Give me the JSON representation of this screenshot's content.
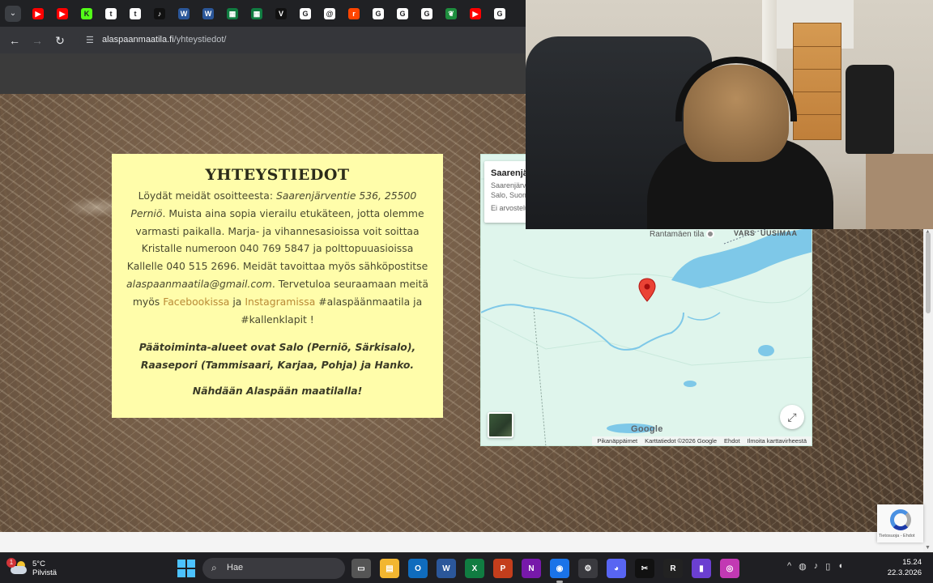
{
  "browser": {
    "tab_icons": [
      {
        "name": "youtube-icon",
        "color": "#ff0000",
        "glyph": "▶"
      },
      {
        "name": "youtube-icon",
        "color": "#ff0000",
        "glyph": "▶"
      },
      {
        "name": "kick-icon",
        "color": "#53fc18",
        "glyph": "K"
      },
      {
        "name": "tiktok-icon",
        "color": "#ffffff",
        "glyph": "t"
      },
      {
        "name": "tiktok-icon",
        "color": "#ffffff",
        "glyph": "t"
      },
      {
        "name": "tiktok-dark-icon",
        "color": "#111111",
        "glyph": "♪"
      },
      {
        "name": "word-icon",
        "color": "#2b579a",
        "glyph": "W"
      },
      {
        "name": "word-icon",
        "color": "#2b579a",
        "glyph": "W"
      },
      {
        "name": "sheets-icon",
        "color": "#107c41",
        "glyph": "▦"
      },
      {
        "name": "sheets-icon",
        "color": "#107c41",
        "glyph": "▦"
      },
      {
        "name": "vercel-icon",
        "color": "#111111",
        "glyph": "V"
      },
      {
        "name": "google-icon",
        "color": "#ffffff",
        "glyph": "G"
      },
      {
        "name": "threads-icon",
        "color": "#ffffff",
        "glyph": "@"
      },
      {
        "name": "reddit-icon",
        "color": "#ff4500",
        "glyph": "r"
      },
      {
        "name": "google-icon",
        "color": "#ffffff",
        "glyph": "G"
      },
      {
        "name": "google-icon",
        "color": "#ffffff",
        "glyph": "G"
      },
      {
        "name": "google-icon",
        "color": "#ffffff",
        "glyph": "G"
      },
      {
        "name": "leaf-icon",
        "color": "#1e8e3e",
        "glyph": "❦"
      },
      {
        "name": "youtube-icon",
        "color": "#ff0000",
        "glyph": "▶"
      },
      {
        "name": "google-icon",
        "color": "#ffffff",
        "glyph": "G"
      }
    ],
    "url_domain": "alaspaanmaatila.fi",
    "url_path": "/yhteystiedot/"
  },
  "contact": {
    "heading": "YHTEYSTIEDOT",
    "intro": "Löydät meidät osoitteesta: ",
    "address": "Saarenjärventie 536, 25500 Perniö",
    "text1": ". Muista aina sopia vierailu etukäteen, jotta olemme varmasti paikalla. Marja- ja vihannesasioissa voit soittaa Kristalle numeroon 040 769 5847 ja polttopuuasioissa Kallelle 040 515 2696. Meidät tavoittaa myös sähköpostitse ",
    "email": "alaspaanmaatila@gmail.com",
    "text2": ". Tervetuloa seuraamaan meitä myös ",
    "facebook": "Facebookissa",
    "and": " ja ",
    "instagram": "Instagramissa",
    "hashtags": "  #alaspäänmaatila ja #kallenklapit !",
    "areas": "Päätoiminta-alueet ovat Salo (Perniö, Särkisalo), Raasepori (Tammisaari, Karjaa, Pohja) ja Hanko.",
    "closing": "Nähdään Alaspään maatilalla!"
  },
  "map": {
    "place_name": "Saarenjärventie",
    "place_address_1": "Saarenjärventie",
    "place_address_2": "Salo, Suomi",
    "place_rating": "Ei arvosteluja",
    "poi_label": "Rantamäen tila",
    "region_label": "UUSIMAA",
    "region_label2": "VARS",
    "google_logo": "Google",
    "footer": {
      "shortcuts": "Pikanäppäimet",
      "map_data": "Karttatiedot ©2026 Google",
      "terms": "Ehdot",
      "report": "Ilmoita karttavirheestä"
    }
  },
  "recaptcha": {
    "text": "Tietosuoja - Ehdot"
  },
  "taskbar": {
    "weather_badge": "1",
    "temp": "5°C",
    "condition": "Pilvistä",
    "search_label": "Hae",
    "pinned": [
      {
        "name": "task-view-icon",
        "color": "#555555",
        "glyph": "▭"
      },
      {
        "name": "file-explorer-icon",
        "color": "#f2b630",
        "glyph": "▤"
      },
      {
        "name": "outlook-icon",
        "color": "#0f6cbd",
        "glyph": "O"
      },
      {
        "name": "word-icon",
        "color": "#2b579a",
        "glyph": "W"
      },
      {
        "name": "excel-icon",
        "color": "#107c41",
        "glyph": "X"
      },
      {
        "name": "powerpoint-icon",
        "color": "#c43e1c",
        "glyph": "P"
      },
      {
        "name": "onenote-icon",
        "color": "#7719aa",
        "glyph": "N"
      },
      {
        "name": "chrome-icon",
        "color": "#1a73e8",
        "glyph": "◉"
      },
      {
        "name": "settings-icon",
        "color": "#3a3a3f",
        "glyph": "⚙"
      },
      {
        "name": "discord-icon",
        "color": "#5865f2",
        "glyph": "◕"
      },
      {
        "name": "capcut-icon",
        "color": "#111111",
        "glyph": "✂"
      },
      {
        "name": "rider-icon",
        "color": "#222222",
        "glyph": "R"
      },
      {
        "name": "app-icon",
        "color": "#6b3fd1",
        "glyph": "▮"
      },
      {
        "name": "photo-app-icon",
        "color": "#c239b3",
        "glyph": "◎"
      }
    ],
    "tray": {
      "chevron": "^",
      "network": "◍",
      "mic": "♪",
      "battery": "▯",
      "volume": "◖"
    },
    "time": "15.24",
    "date": "22.3.2026"
  }
}
